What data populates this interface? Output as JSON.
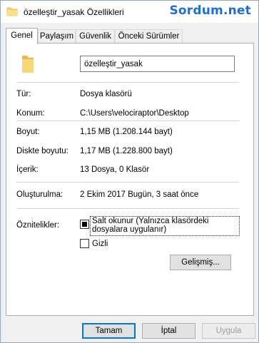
{
  "window": {
    "title": "özelleştir_yasak Özellikleri",
    "watermark": "Sordum.net"
  },
  "tabs": [
    {
      "label": "Genel",
      "active": true
    },
    {
      "label": "Paylaşım",
      "active": false
    },
    {
      "label": "Güvenlik",
      "active": false
    },
    {
      "label": "Önceki Sürümler",
      "active": false
    }
  ],
  "general": {
    "folder_name": "özelleştir_yasak",
    "type_label": "Tür:",
    "type_value": "Dosya klasörü",
    "location_label": "Konum:",
    "location_value": "C:\\Users\\velociraptor\\Desktop",
    "size_label": "Boyut:",
    "size_value": "1,15 MB (1.208.144 bayt)",
    "disk_size_label": "Diskte boyutu:",
    "disk_size_value": "1,17 MB (1.228.800 bayt)",
    "contents_label": "İçerik:",
    "contents_value": "13 Dosya, 0 Klasör",
    "created_label": "Oluşturulma:",
    "created_value": "2 Ekim 2017 Bugün, 3 saat önce",
    "attributes_label": "Öznitelikler:",
    "readonly_label": "Salt okunur (Yalnızca klasördeki dosyalara uygulanır)",
    "readonly_state": "indeterminate",
    "hidden_label": "Gizli",
    "hidden_state": "unchecked",
    "advanced_label": "Gelişmiş..."
  },
  "buttons": {
    "ok_label": "Tamam",
    "cancel_label": "İptal",
    "apply_label": "Uygula"
  },
  "colors": {
    "watermark": "#1d6fd1",
    "focus_border": "#0078d7",
    "folder": "#f8d775"
  }
}
